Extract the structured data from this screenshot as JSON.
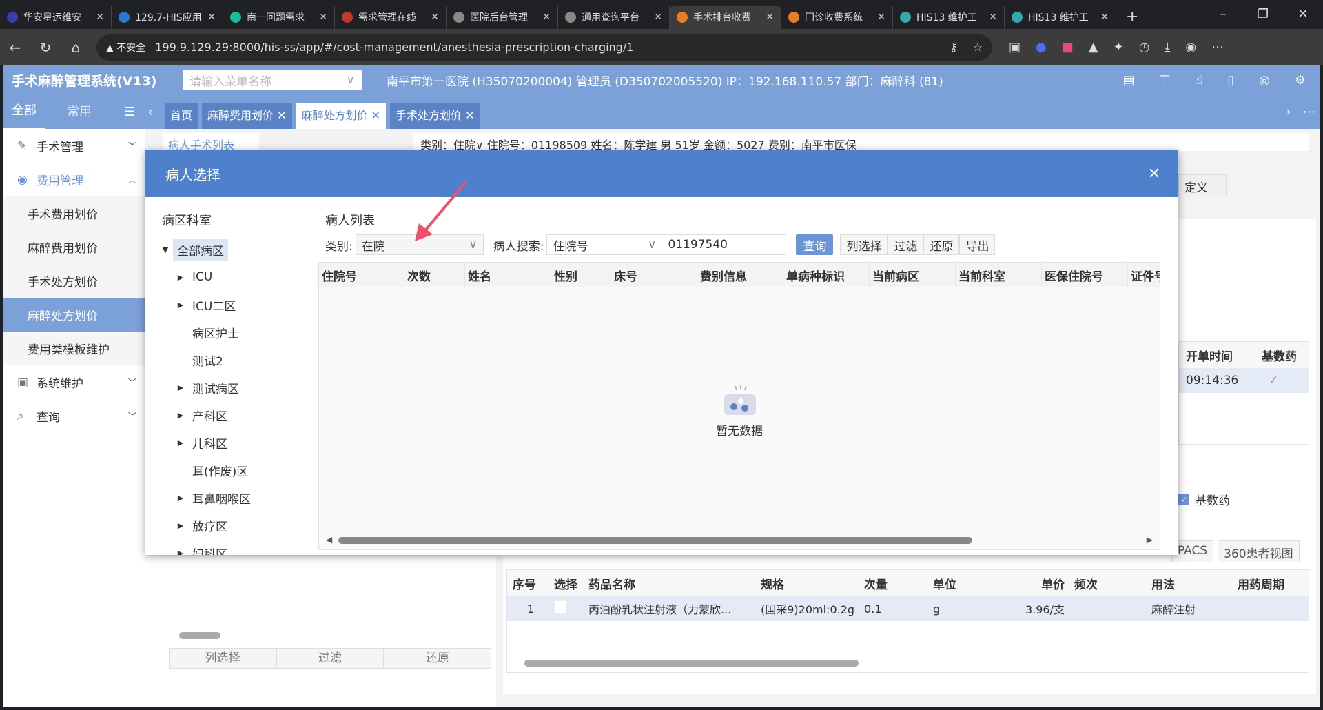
{
  "browser": {
    "tabs": [
      {
        "title": "华安星运维安",
        "color": "#3b3bb0"
      },
      {
        "title": "129.7-HIS应用",
        "color": "#2a7ad1"
      },
      {
        "title": "南一问题需求",
        "color": "#1abc9c"
      },
      {
        "title": "需求管理在线",
        "color": "#c0392b"
      },
      {
        "title": "医院后台管理",
        "color": "#888"
      },
      {
        "title": "通用查询平台",
        "color": "#888"
      },
      {
        "title": "手术排台收费",
        "color": "#e67e22",
        "active": true
      },
      {
        "title": "门诊收费系统",
        "color": "#e67e22"
      },
      {
        "title": "HIS13 维护工",
        "color": "#3aa"
      },
      {
        "title": "HIS13 维护工",
        "color": "#3aa"
      }
    ],
    "insecure_label": "不安全",
    "url": "199.9.129.29:8000/his-ss/app/#/cost-management/anesthesia-prescription-charging/1"
  },
  "app": {
    "title": "手术麻醉管理系统(V13)",
    "menu_search_placeholder": "请输入菜单名称",
    "hospital_info": "南平市第一医院 (H35070200004) 管理员 (D350702005520) IP：192.168.110.57 部门：麻醉科 (81)"
  },
  "nav_tabs": {
    "all": "全部",
    "common": "常用"
  },
  "page_tabs": [
    {
      "label": "首页"
    },
    {
      "label": "麻醉费用划价",
      "closable": true
    },
    {
      "label": "麻醉处方划价",
      "closable": true,
      "active": true
    },
    {
      "label": "手术处方划价",
      "closable": true
    }
  ],
  "sidebar": [
    {
      "label": "手术管理",
      "icon": "pen-icon",
      "expandable": true
    },
    {
      "label": "费用管理",
      "icon": "money-icon",
      "expandable": true,
      "expanded": true,
      "accent": true
    },
    {
      "label": "手术费用划价",
      "sub": true
    },
    {
      "label": "麻醉费用划价",
      "sub": true
    },
    {
      "label": "手术处方划价",
      "sub": true
    },
    {
      "label": "麻醉处方划价",
      "sub": true,
      "selected": true
    },
    {
      "label": "费用类模板维护",
      "sub": true
    },
    {
      "label": "系统维护",
      "icon": "monitor-icon",
      "expandable": true
    },
    {
      "label": "查询",
      "icon": "search-icon",
      "expandable": true
    }
  ],
  "background": {
    "left_tab": "病人手术列表",
    "patient_bar": "类别：住院∨ 住院号：01198509 姓名：陈学建 男 51岁 金额：5027 费别：南平市医保",
    "define_btn": "定义",
    "left_buttons": [
      "列选择",
      "过滤",
      "还原"
    ],
    "right_buttons": [
      "PACS",
      "360患者视图"
    ],
    "upper_table": {
      "headers": [
        "开单时间",
        "基数药"
      ],
      "row": [
        "09:14:36",
        true
      ]
    },
    "base_drug_checkbox": {
      "label": "基数药",
      "checked": true
    },
    "drug_table": {
      "headers": [
        "序号",
        "选择",
        "药品名称",
        "规格",
        "次量",
        "单位",
        "单价",
        "频次",
        "用法",
        "用药周期"
      ],
      "rows": [
        [
          "1",
          "",
          "丙泊酚乳状注射液（力蒙欣...",
          "(国采9)20ml:0.2g",
          "0.1",
          "g",
          "3.96/支",
          "",
          "麻醉注射",
          ""
        ]
      ]
    }
  },
  "modal": {
    "title": "病人选择",
    "tree_title": "病区科室",
    "tree": [
      {
        "label": "全部病区",
        "expanded": true,
        "selected": true,
        "level": 0
      },
      {
        "label": "ICU",
        "children": true
      },
      {
        "label": "ICU二区",
        "children": true
      },
      {
        "label": "病区护士"
      },
      {
        "label": "测试2"
      },
      {
        "label": "测试病区",
        "children": true
      },
      {
        "label": "产科区",
        "children": true
      },
      {
        "label": "儿科区",
        "children": true
      },
      {
        "label": "耳(作废)区"
      },
      {
        "label": "耳鼻咽喉区",
        "children": true
      },
      {
        "label": "放疗区",
        "children": true
      },
      {
        "label": "妇科区",
        "children": true
      }
    ],
    "list_title": "病人列表",
    "category_label": "类别:",
    "category_value": "在院",
    "search_label": "病人搜索:",
    "search_type": "住院号",
    "search_value": "01197540",
    "query_btn": "查询",
    "buttons": [
      "列选择",
      "过滤",
      "还原",
      "导出"
    ],
    "columns": [
      "住院号",
      "次数",
      "姓名",
      "性别",
      "床号",
      "费别信息",
      "单病种标识",
      "当前病区",
      "当前科室",
      "医保住院号",
      "证件号"
    ],
    "empty_text": "暂无数据",
    "annotation_color": "#f0506e"
  }
}
